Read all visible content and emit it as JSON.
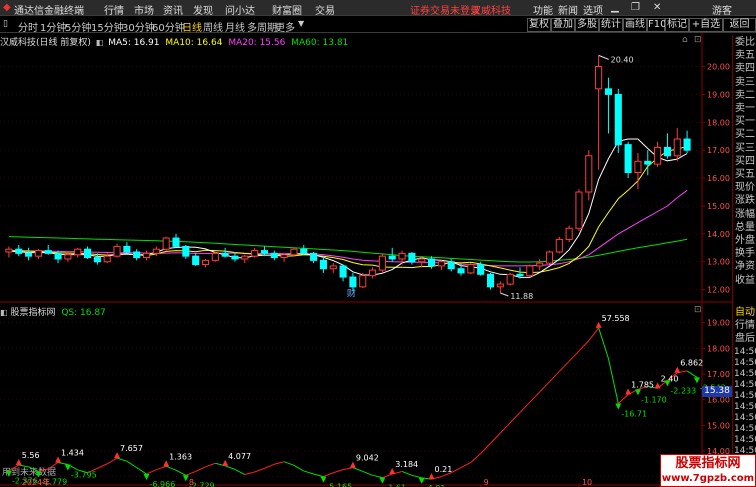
{
  "window": {
    "app_title": "通达信金融终端",
    "menu": [
      "行情",
      "市场",
      "资讯",
      "发现",
      "问小达",
      "财富圈",
      "交易"
    ],
    "notice": "证券交易未登录",
    "stock_tag": "汉威科技",
    "right_menu": [
      "功能",
      "新闻",
      "选项"
    ],
    "guest": "游客",
    "window_controls": [
      "▁",
      "❐",
      "✕"
    ]
  },
  "periods": [
    "分时",
    "1分钟",
    "5分钟",
    "15分钟",
    "30分钟",
    "60分钟",
    "日线",
    "周线",
    "月线",
    "多周期",
    "更多"
  ],
  "active_period": "日线",
  "toolbar_buttons": [
    "复权",
    "叠加",
    "多股",
    "统计",
    "画线",
    "F10",
    "标记",
    "+自选",
    "返回"
  ],
  "main_legend": {
    "stock": "汉威科技(日线 前复权)",
    "ma": [
      {
        "label": "MA5: 16.91",
        "color": "#ffffff"
      },
      {
        "label": "MA10: 16.64",
        "color": "#ffff00"
      },
      {
        "label": "MA20: 15.56",
        "color": "#ff40ff"
      },
      {
        "label": "MA60: 13.81",
        "color": "#00e000"
      }
    ]
  },
  "sub_legend": {
    "name": "股票指标网",
    "value": "QS: 16.87",
    "footer": "用到未来数据"
  },
  "right_panel": {
    "labels": [
      "委比",
      "卖五",
      "卖四",
      "卖三",
      "卖二",
      "卖一",
      "买一",
      "买二",
      "买三",
      "买四",
      "买五",
      "现价",
      "涨跌",
      "涨幅",
      "总量",
      "外盘",
      "换手",
      "净资",
      "收益"
    ],
    "sub_labels": [
      "自动",
      "行情",
      "盘后"
    ],
    "times": [
      "14:50",
      "14:50",
      "14:50",
      "14:50",
      "14:50",
      "14:50",
      "14:50",
      "14:50",
      "14:50",
      "14:50",
      "14:50",
      "14:50",
      "14:50"
    ]
  },
  "price_marker": "15.38",
  "watermark": {
    "line1": "股票指标网",
    "line2": "www.7gpzb.com"
  },
  "colors": {
    "up": "#ff3c3c",
    "down": "#00ffff",
    "ma5": "#ffffff",
    "ma10": "#ffff00",
    "ma20": "#ff40ff",
    "ma60": "#00e000",
    "grid": "#8b0000",
    "sub_line_up": "#ff2020",
    "sub_line_dn": "#00e000"
  },
  "chart_data": [
    {
      "type": "candlestick",
      "title": "汉威科技(日线 前复权)",
      "y_ticks": [
        12.0,
        13.0,
        14.0,
        15.0,
        16.0,
        17.0,
        18.0,
        19.0,
        20.0
      ],
      "ylim": [
        11.7,
        20.7
      ],
      "annotations": {
        "high": "20.40",
        "low": "11.88",
        "event": "财"
      },
      "candles": [
        [
          13.35,
          13.55,
          13.15,
          13.45
        ],
        [
          13.45,
          13.6,
          13.2,
          13.3
        ],
        [
          13.3,
          13.5,
          13.05,
          13.2
        ],
        [
          13.2,
          13.45,
          13.1,
          13.4
        ],
        [
          13.4,
          13.6,
          13.25,
          13.3
        ],
        [
          13.3,
          13.4,
          12.95,
          13.1
        ],
        [
          13.1,
          13.35,
          13.0,
          13.25
        ],
        [
          13.25,
          13.5,
          13.15,
          13.45
        ],
        [
          13.45,
          13.55,
          13.1,
          13.15
        ],
        [
          13.15,
          13.3,
          12.9,
          13.0
        ],
        [
          13.0,
          13.3,
          12.95,
          13.2
        ],
        [
          13.2,
          13.65,
          13.15,
          13.55
        ],
        [
          13.55,
          13.7,
          13.3,
          13.35
        ],
        [
          13.35,
          13.45,
          13.05,
          13.15
        ],
        [
          13.15,
          13.4,
          13.05,
          13.3
        ],
        [
          13.3,
          13.55,
          13.2,
          13.45
        ],
        [
          13.45,
          13.9,
          13.4,
          13.85
        ],
        [
          13.85,
          14.0,
          13.5,
          13.55
        ],
        [
          13.55,
          13.6,
          13.1,
          13.2
        ],
        [
          13.2,
          13.3,
          12.85,
          12.9
        ],
        [
          12.9,
          13.1,
          12.8,
          13.05
        ],
        [
          13.05,
          13.35,
          13.0,
          13.3
        ],
        [
          13.3,
          13.5,
          13.15,
          13.2
        ],
        [
          13.2,
          13.35,
          13.0,
          13.1
        ],
        [
          13.1,
          13.25,
          12.95,
          13.2
        ],
        [
          13.2,
          13.5,
          13.15,
          13.4
        ],
        [
          13.4,
          13.55,
          13.2,
          13.3
        ],
        [
          13.3,
          13.4,
          13.05,
          13.15
        ],
        [
          13.15,
          13.3,
          13.0,
          13.25
        ],
        [
          13.25,
          13.5,
          13.2,
          13.45
        ],
        [
          13.45,
          13.6,
          13.25,
          13.3
        ],
        [
          13.3,
          13.35,
          12.95,
          13.05
        ],
        [
          13.05,
          13.2,
          12.6,
          12.75
        ],
        [
          12.75,
          12.95,
          12.6,
          12.85
        ],
        [
          12.85,
          12.9,
          12.3,
          12.45
        ],
        [
          12.45,
          12.6,
          11.95,
          12.1
        ],
        [
          12.1,
          12.6,
          12.05,
          12.5
        ],
        [
          12.5,
          12.8,
          12.4,
          12.7
        ],
        [
          12.7,
          13.3,
          12.6,
          13.2
        ],
        [
          13.2,
          13.5,
          13.0,
          13.1
        ],
        [
          13.1,
          13.4,
          12.9,
          13.3
        ],
        [
          13.3,
          13.35,
          12.9,
          13.0
        ],
        [
          13.0,
          13.2,
          12.8,
          13.1
        ],
        [
          13.1,
          13.2,
          12.75,
          12.85
        ],
        [
          12.85,
          13.05,
          12.7,
          13.0
        ],
        [
          13.0,
          13.1,
          12.65,
          12.75
        ],
        [
          12.75,
          12.9,
          12.5,
          12.6
        ],
        [
          12.6,
          12.95,
          12.55,
          12.9
        ],
        [
          12.9,
          13.0,
          12.5,
          12.55
        ],
        [
          12.55,
          12.6,
          12.0,
          12.1
        ],
        [
          12.1,
          12.3,
          11.88,
          12.2
        ],
        [
          12.2,
          12.6,
          12.15,
          12.55
        ],
        [
          12.55,
          12.8,
          12.4,
          12.5
        ],
        [
          12.5,
          12.9,
          12.45,
          12.85
        ],
        [
          12.85,
          13.1,
          12.7,
          12.95
        ],
        [
          12.95,
          13.4,
          12.9,
          13.35
        ],
        [
          13.35,
          13.9,
          13.3,
          13.8
        ],
        [
          13.8,
          14.3,
          13.7,
          14.2
        ],
        [
          14.2,
          15.6,
          14.1,
          15.5
        ],
        [
          15.5,
          17.0,
          15.2,
          16.8
        ],
        [
          19.2,
          20.4,
          16.3,
          20.0
        ],
        [
          19.2,
          19.6,
          17.6,
          19.0
        ],
        [
          19.0,
          19.2,
          16.9,
          17.2
        ],
        [
          17.2,
          17.3,
          16.0,
          16.2
        ],
        [
          16.2,
          16.9,
          15.6,
          16.6
        ],
        [
          16.6,
          17.0,
          16.1,
          16.5
        ],
        [
          16.5,
          17.3,
          16.4,
          17.1
        ],
        [
          17.1,
          17.6,
          16.7,
          16.8
        ],
        [
          16.8,
          17.8,
          16.6,
          17.4
        ],
        [
          17.4,
          17.7,
          16.9,
          17.0
        ]
      ],
      "ma5": [
        13.38,
        13.36,
        13.33,
        13.32,
        13.33,
        13.27,
        13.25,
        13.26,
        13.25,
        13.19,
        13.2,
        13.27,
        13.29,
        13.25,
        13.25,
        13.35,
        13.47,
        13.51,
        13.53,
        13.52,
        13.46,
        13.33,
        13.25,
        13.14,
        13.14,
        13.21,
        13.24,
        13.24,
        13.26,
        13.28,
        13.29,
        13.25,
        13.16,
        13.04,
        12.88,
        12.64,
        12.53,
        12.52,
        12.59,
        12.72,
        12.96,
        13.06,
        13.14,
        13.07,
        13.05,
        13.0,
        12.86,
        12.82,
        12.77,
        12.64,
        12.55,
        12.54,
        12.44,
        12.44,
        12.61,
        12.84,
        13.09,
        13.43,
        13.96,
        14.73,
        15.95,
        16.7,
        17.32,
        17.4,
        17.4,
        17.06,
        16.74,
        16.62,
        16.68,
        16.88
      ],
      "ma10": [
        13.4,
        13.39,
        13.38,
        13.36,
        13.35,
        13.32,
        13.31,
        13.3,
        13.29,
        13.26,
        13.24,
        13.26,
        13.27,
        13.25,
        13.22,
        13.28,
        13.37,
        13.4,
        13.39,
        13.36,
        13.41,
        13.4,
        13.38,
        13.33,
        13.3,
        13.27,
        13.24,
        13.24,
        13.2,
        13.21,
        13.25,
        13.24,
        13.2,
        13.15,
        13.08,
        12.97,
        12.89,
        12.88,
        12.81,
        12.8,
        12.8,
        12.79,
        12.83,
        12.83,
        12.89,
        12.98,
        12.96,
        12.98,
        12.92,
        12.85,
        12.78,
        12.7,
        12.63,
        12.61,
        12.63,
        12.7,
        12.79,
        12.94,
        13.2,
        13.55,
        14.25,
        14.77,
        15.26,
        15.56,
        15.9,
        16.42,
        16.72,
        16.97,
        17.04,
        17.14
      ],
      "ma20": [
        13.4,
        13.4,
        13.39,
        13.39,
        13.38,
        13.37,
        13.36,
        13.36,
        13.35,
        13.34,
        13.33,
        13.32,
        13.32,
        13.32,
        13.31,
        13.3,
        13.31,
        13.32,
        13.31,
        13.3,
        13.3,
        13.3,
        13.31,
        13.31,
        13.3,
        13.3,
        13.3,
        13.3,
        13.29,
        13.28,
        13.29,
        13.28,
        13.25,
        13.21,
        13.16,
        13.1,
        13.05,
        13.03,
        13.02,
        13.0,
        12.99,
        12.98,
        12.98,
        12.97,
        12.96,
        12.95,
        12.92,
        12.9,
        12.88,
        12.86,
        12.85,
        12.85,
        12.85,
        12.86,
        12.87,
        12.89,
        12.93,
        13.0,
        13.11,
        13.25,
        13.5,
        13.75,
        14.0,
        14.2,
        14.4,
        14.6,
        14.8,
        15.0,
        15.3,
        15.56
      ],
      "ma60": [
        13.9,
        13.89,
        13.88,
        13.87,
        13.86,
        13.85,
        13.84,
        13.83,
        13.82,
        13.81,
        13.8,
        13.79,
        13.78,
        13.77,
        13.76,
        13.75,
        13.74,
        13.73,
        13.72,
        13.7,
        13.68,
        13.66,
        13.64,
        13.62,
        13.6,
        13.58,
        13.56,
        13.54,
        13.52,
        13.5,
        13.48,
        13.46,
        13.44,
        13.42,
        13.4,
        13.37,
        13.34,
        13.31,
        13.28,
        13.25,
        13.22,
        13.2,
        13.18,
        13.16,
        13.14,
        13.12,
        13.1,
        13.08,
        13.06,
        13.04,
        13.02,
        13.0,
        12.99,
        12.99,
        13.0,
        13.02,
        13.05,
        13.08,
        13.12,
        13.17,
        13.23,
        13.3,
        13.37,
        13.44,
        13.5,
        13.56,
        13.62,
        13.68,
        13.74,
        13.81
      ]
    },
    {
      "type": "line",
      "title": "QS: 16.87",
      "y_ticks": [
        13.0,
        14.0,
        15.0,
        16.0,
        17.0,
        18.0,
        19.0
      ],
      "ylim": [
        12.75,
        19.3
      ],
      "x_ticks": [
        {
          "i": 1,
          "label": "2024年"
        },
        {
          "i": 18,
          "label": "8"
        },
        {
          "i": 48,
          "label": "9"
        },
        {
          "i": 58,
          "label": "10"
        }
      ],
      "values": [
        13.23,
        13.45,
        13.38,
        13.2,
        13.3,
        13.55,
        13.47,
        13.26,
        13.15,
        13.32,
        13.5,
        13.72,
        13.6,
        13.35,
        13.1,
        13.27,
        13.4,
        13.25,
        13.05,
        13.2,
        13.38,
        13.52,
        13.42,
        13.28,
        13.08,
        13.18,
        13.32,
        13.48,
        13.58,
        13.44,
        13.22,
        13.1,
        13.0,
        13.15,
        13.27,
        13.35,
        13.2,
        13.05,
        12.96,
        13.1,
        13.2,
        13.05,
        12.95,
        12.9,
        13.0,
        13.15,
        13.35,
        13.55,
        13.9,
        14.3,
        14.7,
        15.1,
        15.5,
        15.9,
        16.3,
        16.7,
        17.1,
        17.5,
        17.9,
        18.3,
        18.8,
        17.6,
        15.85,
        16.2,
        16.4,
        16.52,
        16.44,
        16.75,
        17.05,
        17.12,
        16.87
      ],
      "labels": [
        {
          "i": 0,
          "text": "-2.376",
          "dir": "dn"
        },
        {
          "i": 1,
          "text": "5.56",
          "dir": "up"
        },
        {
          "i": 3,
          "text": "-1.779",
          "dir": "dn"
        },
        {
          "i": 5,
          "text": "1.434",
          "dir": "up"
        },
        {
          "i": 6,
          "text": "-3.795",
          "dir": "dn"
        },
        {
          "i": 11,
          "text": "7.657",
          "dir": "up"
        },
        {
          "i": 14,
          "text": "-6.966",
          "dir": "dn"
        },
        {
          "i": 16,
          "text": "1.363",
          "dir": "up"
        },
        {
          "i": 18,
          "text": "-2.729",
          "dir": "dn"
        },
        {
          "i": 22,
          "text": "4.077",
          "dir": "up"
        },
        {
          "i": 32,
          "text": "-5.165",
          "dir": "dn"
        },
        {
          "i": 35,
          "text": "9.042",
          "dir": "up"
        },
        {
          "i": 38,
          "text": "-1.61",
          "dir": "dn"
        },
        {
          "i": 39,
          "text": "3.184",
          "dir": "up"
        },
        {
          "i": 42,
          "text": "-4.01",
          "dir": "dn"
        },
        {
          "i": 43,
          "text": "0.21",
          "dir": "up"
        },
        {
          "i": 60,
          "text": "57.558",
          "dir": "up"
        },
        {
          "i": 62,
          "text": "-16.71",
          "dir": "dn"
        },
        {
          "i": 63,
          "text": "1.785",
          "dir": "up"
        },
        {
          "i": 64,
          "text": "-1.170",
          "dir": "dn"
        },
        {
          "i": 66,
          "text": "2.40",
          "dir": "up"
        },
        {
          "i": 67,
          "text": "-2.233",
          "dir": "dn"
        },
        {
          "i": 68,
          "text": "6.862",
          "dir": "up"
        },
        {
          "i": 70,
          "text": "-2.542",
          "dir": "dn"
        }
      ]
    }
  ]
}
